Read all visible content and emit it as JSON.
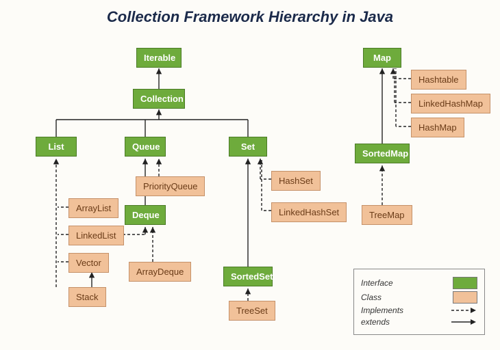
{
  "title": "Collection Framework Hierarchy in Java",
  "nodes": {
    "iterable": "Iterable",
    "collection": "Collection",
    "list": "List",
    "queue": "Queue",
    "set": "Set",
    "deque": "Deque",
    "sortedset": "SortedSet",
    "map": "Map",
    "sortedmap": "SortedMap",
    "arraylist": "ArrayList",
    "linkedlist": "LinkedList",
    "vector": "Vector",
    "stack": "Stack",
    "priorityqueue": "PriorityQueue",
    "arraydeque": "ArrayDeque",
    "hashset": "HashSet",
    "linkedhashset": "LinkedHashSet",
    "treeset": "TreeSet",
    "hashtable": "Hashtable",
    "linkedhashmap": "LinkedHashMap",
    "hashmap": "HashMap",
    "treemap": "TreeMap"
  },
  "legend": {
    "interface": "Interface",
    "class": "Class",
    "implements": "Implements",
    "extends": "extends"
  },
  "colors": {
    "interface": "#6eab3c",
    "class": "#f1c199"
  }
}
